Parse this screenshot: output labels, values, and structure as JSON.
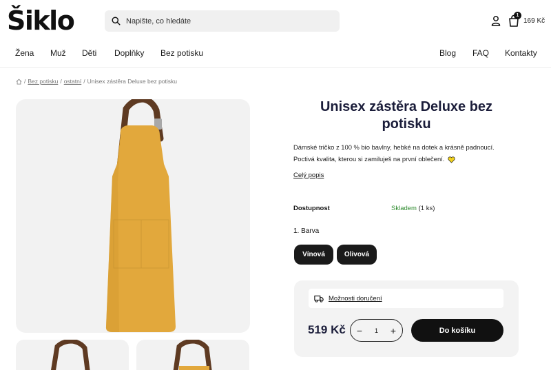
{
  "header": {
    "logo_text": "Šiklo",
    "search_placeholder": "Napište, co hledáte",
    "cart_count": "1",
    "cart_total": "169 Kč"
  },
  "nav": {
    "left": [
      "Žena",
      "Muž",
      "Děti",
      "Doplňky",
      "Bez potisku"
    ],
    "right": [
      "Blog",
      "FAQ",
      "Kontakty"
    ]
  },
  "breadcrumb": {
    "items": [
      "Bez potisku",
      "ostatní"
    ],
    "current": "Unisex zástěra Deluxe bez potisku",
    "separator": "/"
  },
  "product": {
    "title": "Unisex zástěra Deluxe bez potisku",
    "description_line1": "Dámské tričko z 100 % bio bavlny, hebké na dotek a krásně padnoucí.",
    "description_line2": "Poctivá kvalita, kterou si zamiluješ na první oblečení.",
    "full_description_link": "Celý popis",
    "availability_label": "Dostupnost",
    "availability_status": "Skladem",
    "availability_count": "(1 ks)",
    "color_label": "1. Barva",
    "colors": [
      "Vínová",
      "Olivová"
    ],
    "apron_color": "#e2a83c",
    "strap_color": "#5e3a22"
  },
  "purchase": {
    "delivery_link": "Možnosti doručení",
    "price": "519 Kč",
    "quantity": "1",
    "minus": "−",
    "plus": "+",
    "add_to_cart": "Do košíku"
  },
  "colors": {
    "brand_dark": "#1b1d3a",
    "stock_green": "#2e8b2e",
    "heart_yellow": "#f2d21c"
  }
}
